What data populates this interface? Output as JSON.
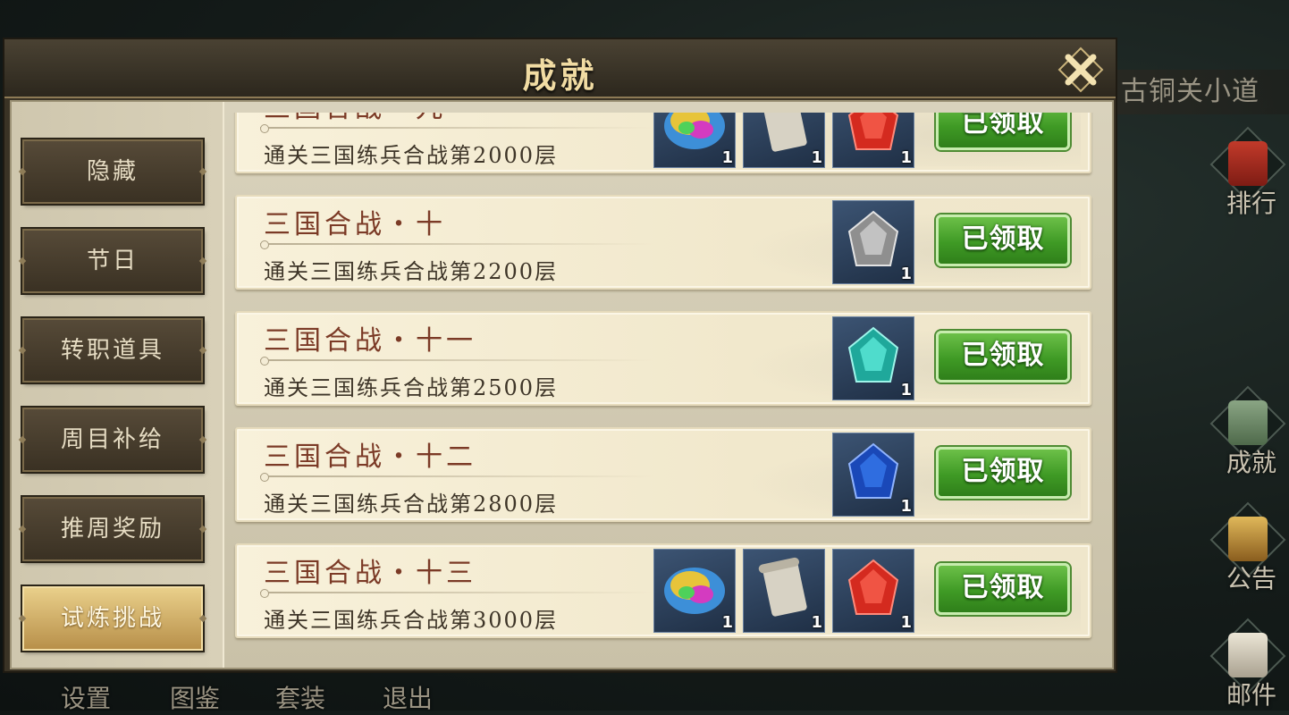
{
  "background": {
    "location_banner": "古铜关小道",
    "side_buttons": [
      {
        "label": "排行",
        "icon": "ranking-scroll-icon",
        "color": "#b03325"
      },
      {
        "label": "成就",
        "icon": "achievement-cauldron-icon",
        "color": "#6f8b6a"
      },
      {
        "label": "公告",
        "icon": "announcement-horn-icon",
        "color": "#c59a3a"
      },
      {
        "label": "邮件",
        "icon": "mail-icon",
        "color": "#d9d3c4"
      }
    ],
    "bottom_menu": [
      "设置",
      "图鉴",
      "套装",
      "退出"
    ]
  },
  "dialog": {
    "title": "成就",
    "close_icon": "close-x-icon"
  },
  "tabs": [
    {
      "label": "隐藏",
      "active": false
    },
    {
      "label": "节日",
      "active": false
    },
    {
      "label": "转职道具",
      "active": false
    },
    {
      "label": "周目补给",
      "active": false
    },
    {
      "label": "推周奖励",
      "active": false
    },
    {
      "label": "试炼挑战",
      "active": true
    }
  ],
  "achievements": [
    {
      "title": "三国合战・九",
      "desc": "通关三国练兵合战第2000层",
      "rewards": [
        {
          "icon": "rainbow-orb-icon",
          "qty": "1",
          "color": "#e7c43a"
        },
        {
          "icon": "scroll-icon",
          "qty": "1",
          "color": "#cfcabd"
        },
        {
          "icon": "red-gem-icon",
          "qty": "1",
          "color": "#d42a1f"
        }
      ],
      "button": "已领取"
    },
    {
      "title": "三国合战・十",
      "desc": "通关三国练兵合战第2200层",
      "rewards": [
        {
          "icon": "gray-gem-icon",
          "qty": "1",
          "color": "#a9a9a9"
        }
      ],
      "button": "已领取"
    },
    {
      "title": "三国合战・十一",
      "desc": "通关三国练兵合战第2500层",
      "rewards": [
        {
          "icon": "cyan-gem-icon",
          "qty": "1",
          "color": "#2fc1b3"
        }
      ],
      "button": "已领取"
    },
    {
      "title": "三国合战・十二",
      "desc": "通关三国练兵合战第2800层",
      "rewards": [
        {
          "icon": "blue-gem-icon",
          "qty": "1",
          "color": "#1f57d1"
        }
      ],
      "button": "已领取"
    },
    {
      "title": "三国合战・十三",
      "desc": "通关三国练兵合战第3000层",
      "rewards": [
        {
          "icon": "rainbow-orb-icon",
          "qty": "1",
          "color": "#e7c43a"
        },
        {
          "icon": "scroll-icon",
          "qty": "1",
          "color": "#cfcabd"
        },
        {
          "icon": "red-gem-icon",
          "qty": "1",
          "color": "#d42a1f"
        }
      ],
      "button": "已领取"
    }
  ]
}
